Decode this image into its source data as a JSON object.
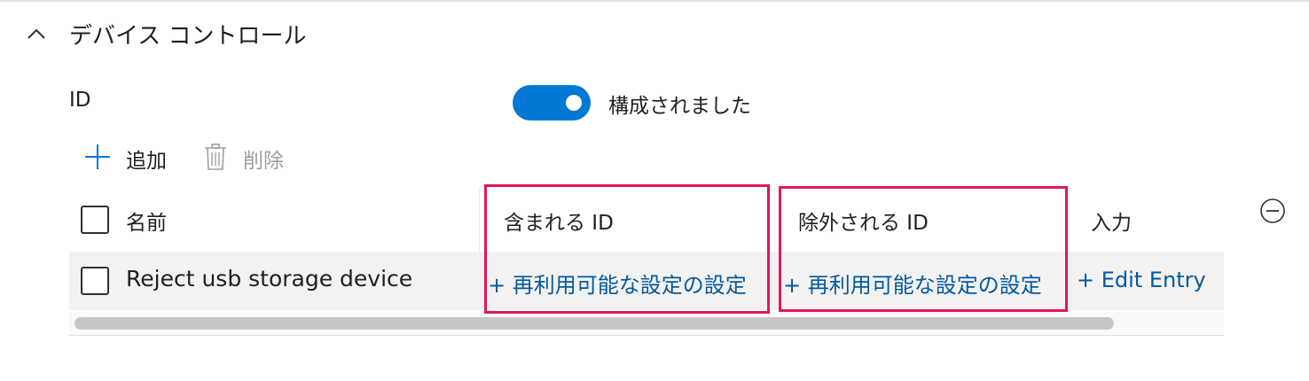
{
  "section": {
    "title": "デバイス コントロール",
    "chevron_icon": "chevron-up-icon"
  },
  "setting": {
    "label": "ID",
    "toggle_state": "on",
    "toggle_label": "構成されました",
    "toggle_color": "#0078d4"
  },
  "commands": {
    "add_label": "追加",
    "add_icon": "plus-icon",
    "delete_label": "削除",
    "delete_icon": "trash-icon",
    "delete_enabled": false
  },
  "table": {
    "columns": [
      "名前",
      "含まれる ID",
      "除外される ID",
      "入力"
    ],
    "rows": [
      {
        "name": "Reject usb storage device",
        "included": "+ 再利用可能な設定の設定",
        "excluded": "+ 再利用可能な設定の設定",
        "entry": "+ Edit Entry"
      }
    ],
    "remove_icon": "minus-circle-icon"
  },
  "colors": {
    "accent": "#0078d4",
    "link": "#005a9e",
    "highlight": "#e3165b"
  }
}
